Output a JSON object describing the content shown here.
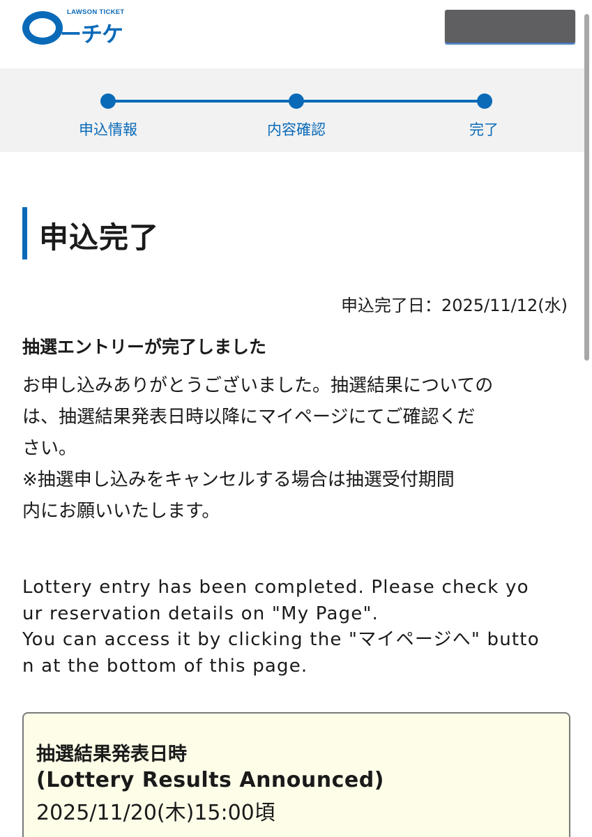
{
  "header": {
    "logo_sub": "LAWSON TICKET",
    "logo_word": "ーチケ"
  },
  "steps": [
    {
      "label": "申込情報"
    },
    {
      "label": "内容確認"
    },
    {
      "label": "完了"
    }
  ],
  "main": {
    "title": "申込完了",
    "completion_date": "申込完了日：2025/11/12(水)",
    "subhead": "抽選エントリーが完了しました",
    "body_jp": [
      "お申し込みありがとうございました。抽選結果についての",
      "は、抽選結果発表日時以降にマイページにてご確認くだ",
      "さい。",
      "※抽選申し込みをキャンセルする場合は抽選受付期間",
      "内にお願いいたします。"
    ],
    "body_en": [
      "Lottery entry has been completed. Please check yo",
      "ur reservation details on \"My Page\".",
      "You can access it by clicking the \"マイページへ\" butto",
      "n at the bottom of this page."
    ]
  },
  "result": {
    "title": "抽選結果発表日時",
    "title_en": "(Lottery Results Announced)",
    "date": "2025/11/20(木)15:00頃"
  },
  "colors": {
    "accent": "#0a6ab8",
    "stepbar_bg": "#f2f2f2",
    "result_bg": "#fdfde8"
  }
}
